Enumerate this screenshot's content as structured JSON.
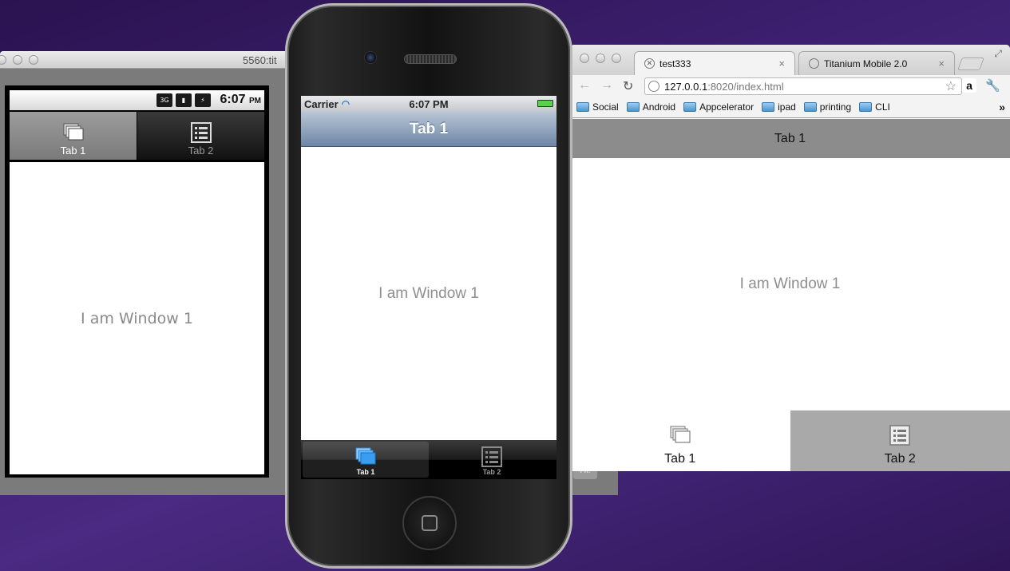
{
  "android": {
    "window_title": "5560:tit",
    "status_icons": [
      "3G",
      "▮",
      "⚡"
    ],
    "time": "6:07",
    "time_suffix": "PM",
    "tabs": [
      {
        "label": "Tab 1",
        "icon": "windows-icon"
      },
      {
        "label": "Tab 2",
        "icon": "list-icon"
      }
    ],
    "content_text": "I am Window 1",
    "partial_button": "Hi!"
  },
  "iphone": {
    "carrier": "Carrier",
    "time": "6:07 PM",
    "nav_title": "Tab 1",
    "content_text": "I am Window 1",
    "tabs": [
      {
        "label": "Tab 1",
        "icon": "windows-icon"
      },
      {
        "label": "Tab 2",
        "icon": "list-icon"
      }
    ]
  },
  "chrome": {
    "tabs": [
      {
        "label": "test333",
        "close": "×"
      },
      {
        "label": "Titanium Mobile 2.0",
        "close": "×"
      }
    ],
    "url_host": "127.0.0.1",
    "url_path": ":8020/index.html",
    "bookmarks": [
      "Social",
      "Android",
      "Appcelerator",
      "ipad",
      "printing",
      "CLI"
    ],
    "bookmarks_more": "»",
    "amazon": "a",
    "page": {
      "header_title": "Tab 1",
      "content_text": "I am Window 1",
      "tabs": [
        {
          "label": "Tab 1",
          "icon": "windows-icon"
        },
        {
          "label": "Tab 2",
          "icon": "list-icon"
        }
      ]
    }
  },
  "colors": {
    "desktop": "#3c1f6e",
    "ios_nav": "#6d86a6",
    "web_header": "#8c8c8c",
    "web_inactive_tab": "#a9a9a9"
  }
}
